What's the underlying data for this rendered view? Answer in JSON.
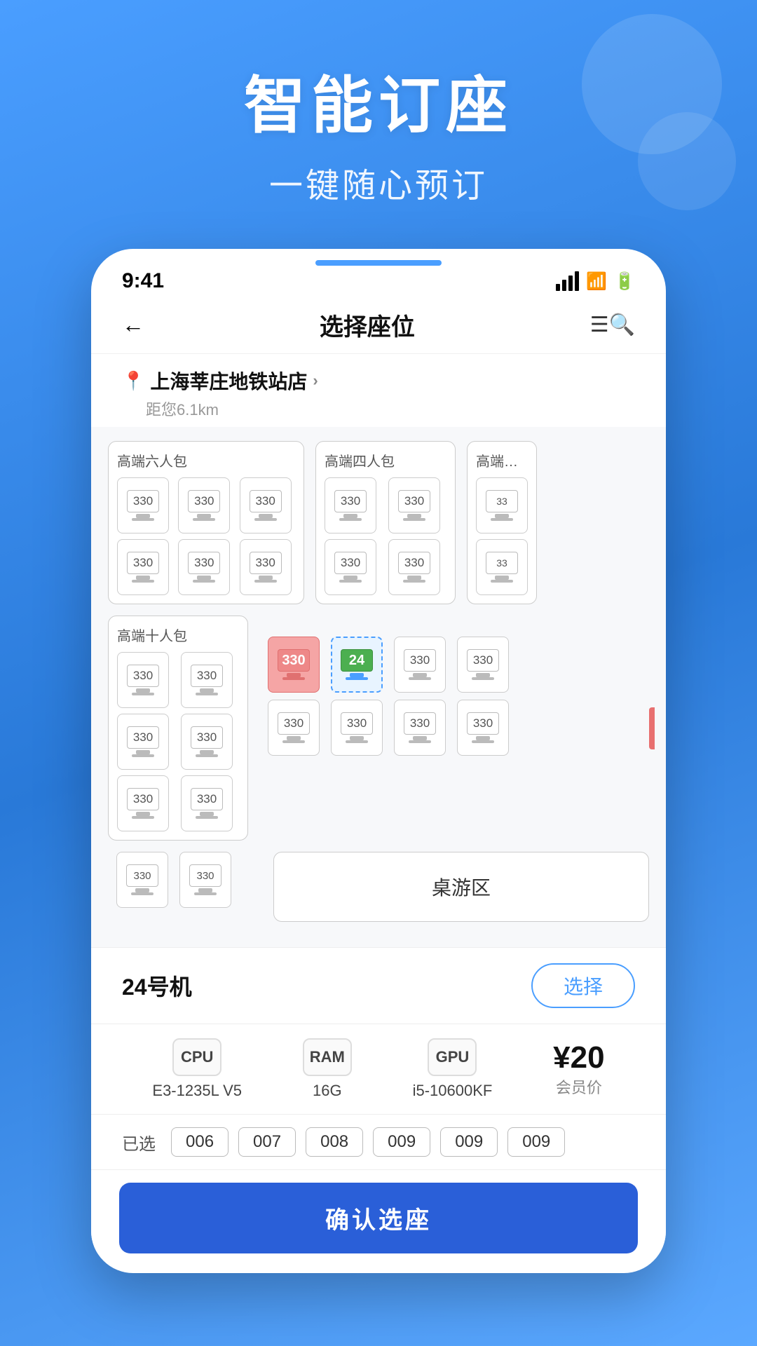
{
  "hero": {
    "title": "智能订座",
    "subtitle": "一键随心预订"
  },
  "status_bar": {
    "time": "9:41",
    "signal": 4,
    "wifi": true,
    "battery": true
  },
  "nav": {
    "title": "选择座位"
  },
  "location": {
    "name": "上海莘庄地铁站店",
    "distance": "距您6.1km"
  },
  "sections": [
    {
      "id": "section-6pack",
      "label": "高端六人包",
      "cols": 3,
      "seats": [
        {
          "num": "330",
          "state": "normal"
        },
        {
          "num": "330",
          "state": "normal"
        },
        {
          "num": "330",
          "state": "normal"
        },
        {
          "num": "330",
          "state": "normal"
        },
        {
          "num": "330",
          "state": "normal"
        },
        {
          "num": "330",
          "state": "normal"
        }
      ]
    },
    {
      "id": "section-4pack",
      "label": "高端四人包",
      "cols": 2,
      "seats": [
        {
          "num": "330",
          "state": "normal"
        },
        {
          "num": "330",
          "state": "normal"
        },
        {
          "num": "330",
          "state": "normal"
        },
        {
          "num": "330",
          "state": "normal"
        }
      ]
    },
    {
      "id": "section-2pack",
      "label": "高端双人",
      "cols": 1,
      "seats": [
        {
          "num": "33",
          "state": "normal"
        },
        {
          "num": "33",
          "state": "normal"
        }
      ]
    }
  ],
  "section_10pack": {
    "label": "高端十人包",
    "left_seats": [
      {
        "num": "330",
        "state": "normal"
      },
      {
        "num": "330",
        "state": "normal"
      },
      {
        "num": "330",
        "state": "normal"
      },
      {
        "num": "330",
        "state": "normal"
      },
      {
        "num": "330",
        "state": "normal"
      },
      {
        "num": "330",
        "state": "normal"
      }
    ],
    "right_seats": [
      {
        "num": "330",
        "state": "occupied"
      },
      {
        "num": "24",
        "state": "selected"
      },
      {
        "num": "330",
        "state": "normal"
      },
      {
        "num": "330",
        "state": "normal"
      },
      {
        "num": "330",
        "state": "normal"
      },
      {
        "num": "330",
        "state": "normal"
      },
      {
        "num": "330",
        "state": "normal"
      },
      {
        "num": "330",
        "state": "normal"
      }
    ]
  },
  "table_area": {
    "label": "桌游区"
  },
  "machine": {
    "name": "24号机",
    "select_label": "选择"
  },
  "specs": [
    {
      "icon": "CPU",
      "label": "E3-1235L V5"
    },
    {
      "icon": "RAM",
      "label": "16G"
    },
    {
      "icon": "GPU",
      "label": "i5-10600KF"
    },
    {
      "price": "¥20",
      "price_label": "会员价"
    }
  ],
  "selected_seats": {
    "label": "已选",
    "seats": [
      "006",
      "007",
      "008",
      "009",
      "009",
      "009"
    ]
  },
  "confirm_button": {
    "label": "确认选座"
  }
}
